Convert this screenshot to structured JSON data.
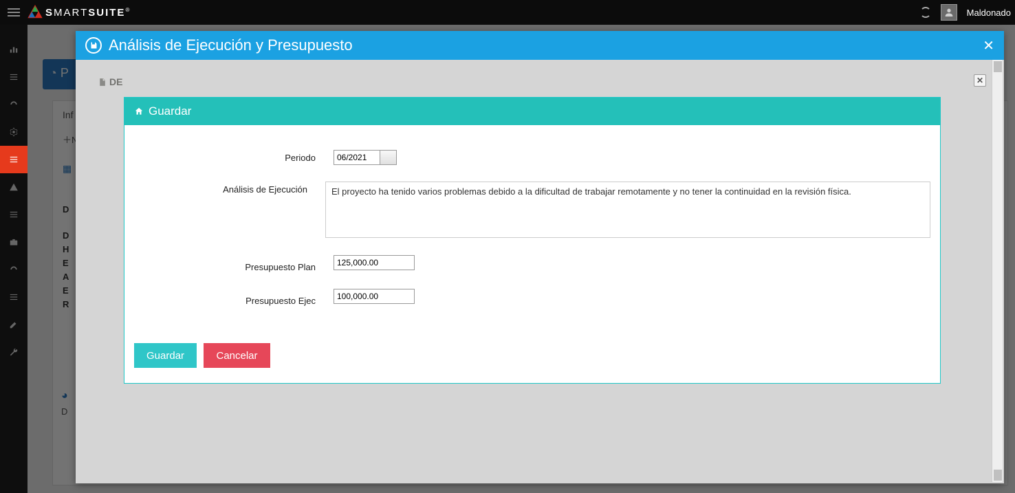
{
  "brand": {
    "name_light": "MART",
    "name_start": "S",
    "name_bold": "SUITE",
    "reg": "®"
  },
  "user": {
    "name": "Maldonado"
  },
  "back": {
    "blue_strip_prefix": "P",
    "tab_label": "Inf",
    "new_label": "Nue",
    "d_heading": "D",
    "d_lines_0": "D",
    "d_lines_1": "H",
    "d_lines_2": "E",
    "d_lines_3": "A",
    "d_lines_4": "E",
    "d_lines_5": "R",
    "side_d_below": "D"
  },
  "outer_modal": {
    "title": "Análisis de Ejecución y Presupuesto",
    "de_label": "DE"
  },
  "inner_modal": {
    "title": "Guardar",
    "labels": {
      "periodo": "Periodo",
      "analisis": "Análisis de Ejecución",
      "presup_plan": "Presupuesto Plan",
      "presup_ejec": "Presupuesto Ejec"
    },
    "values": {
      "periodo": "06/2021",
      "analisis": "El proyecto ha tenido varios problemas debido a la dificultad de trabajar remotamente y no tener la continuidad en la revisión física.",
      "presup_plan": "125,000.00",
      "presup_ejec": "100,000.00"
    },
    "buttons": {
      "save": "Guardar",
      "cancel": "Cancelar"
    }
  }
}
